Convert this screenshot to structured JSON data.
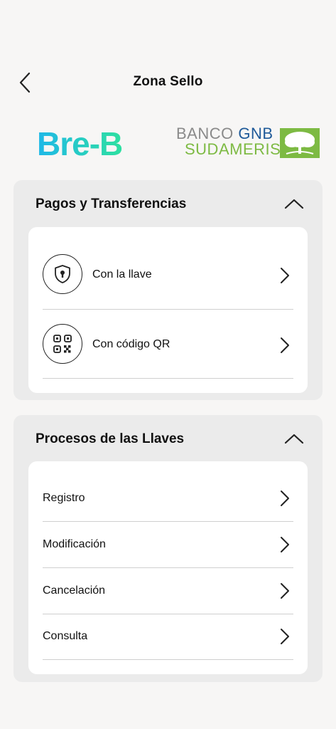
{
  "header": {
    "title": "Zona Sello"
  },
  "logos": {
    "breb": "Bre-B",
    "bank_line1_a": "BANCO ",
    "bank_line1_b": "GNB",
    "bank_line2": "SUDAMERIS"
  },
  "sections": [
    {
      "title": "Pagos y Transferencias",
      "items": [
        {
          "label": "Con la llave",
          "icon": "keyhole-shield-icon"
        },
        {
          "label": "Con código QR",
          "icon": "qr-code-icon"
        }
      ]
    },
    {
      "title": "Procesos de las Llaves",
      "items": [
        {
          "label": "Registro"
        },
        {
          "label": "Modificación"
        },
        {
          "label": "Cancelación"
        },
        {
          "label": "Consulta"
        }
      ]
    }
  ],
  "colors": {
    "breb_gradient_start": "#1fb8e8",
    "breb_gradient_end": "#2ee0a0",
    "gnb_blue": "#1f5a99",
    "sudameris_green": "#7dba43",
    "background": "#f7f6f5",
    "section_bg": "#ebebeb",
    "card_bg": "#ffffff"
  }
}
